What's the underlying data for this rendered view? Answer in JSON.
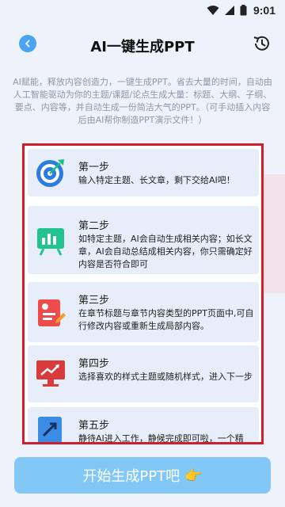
{
  "status_bar": {
    "time": "9:01"
  },
  "header": {
    "title": "AI一键生成PPT"
  },
  "intro": {
    "text": "AI赋能，释放内容创造力，一键生成PPT。省去大量的时间，自动由人工智能驱动为你的主题/课题/论点生成大量：标题、大纲、子纲、要点、内容等，并自动生成一份简洁大气的PPT。（可手动插入内容后由AI帮你制造PPT演示文件！）"
  },
  "steps": [
    {
      "title": "第一步",
      "desc": "输入特定主题、长文章，剩下交给AI吧！"
    },
    {
      "title": "第二步",
      "desc": "如特定主题，AI会自动生成相关内容；如长文章，AI会自动总结成相关内容，你只需确定好内容是否符合即可"
    },
    {
      "title": "第三步",
      "desc": "在章节标题与章节内容类型的PPT页面中,可自行修改内容或重新生成局部内容。"
    },
    {
      "title": "第四步",
      "desc": "选择喜欢的样式主题或随机样式，进入下一步"
    },
    {
      "title": "第五步",
      "desc": "静待AI进入工作，静候完成即可啦，一个精"
    }
  ],
  "start_button": {
    "label": "开始生成PPT吧",
    "emoji": "👉"
  },
  "colors": {
    "accent": "#4aa3f4",
    "button": "#82c8f7",
    "highlight_border": "#d21e2b"
  }
}
